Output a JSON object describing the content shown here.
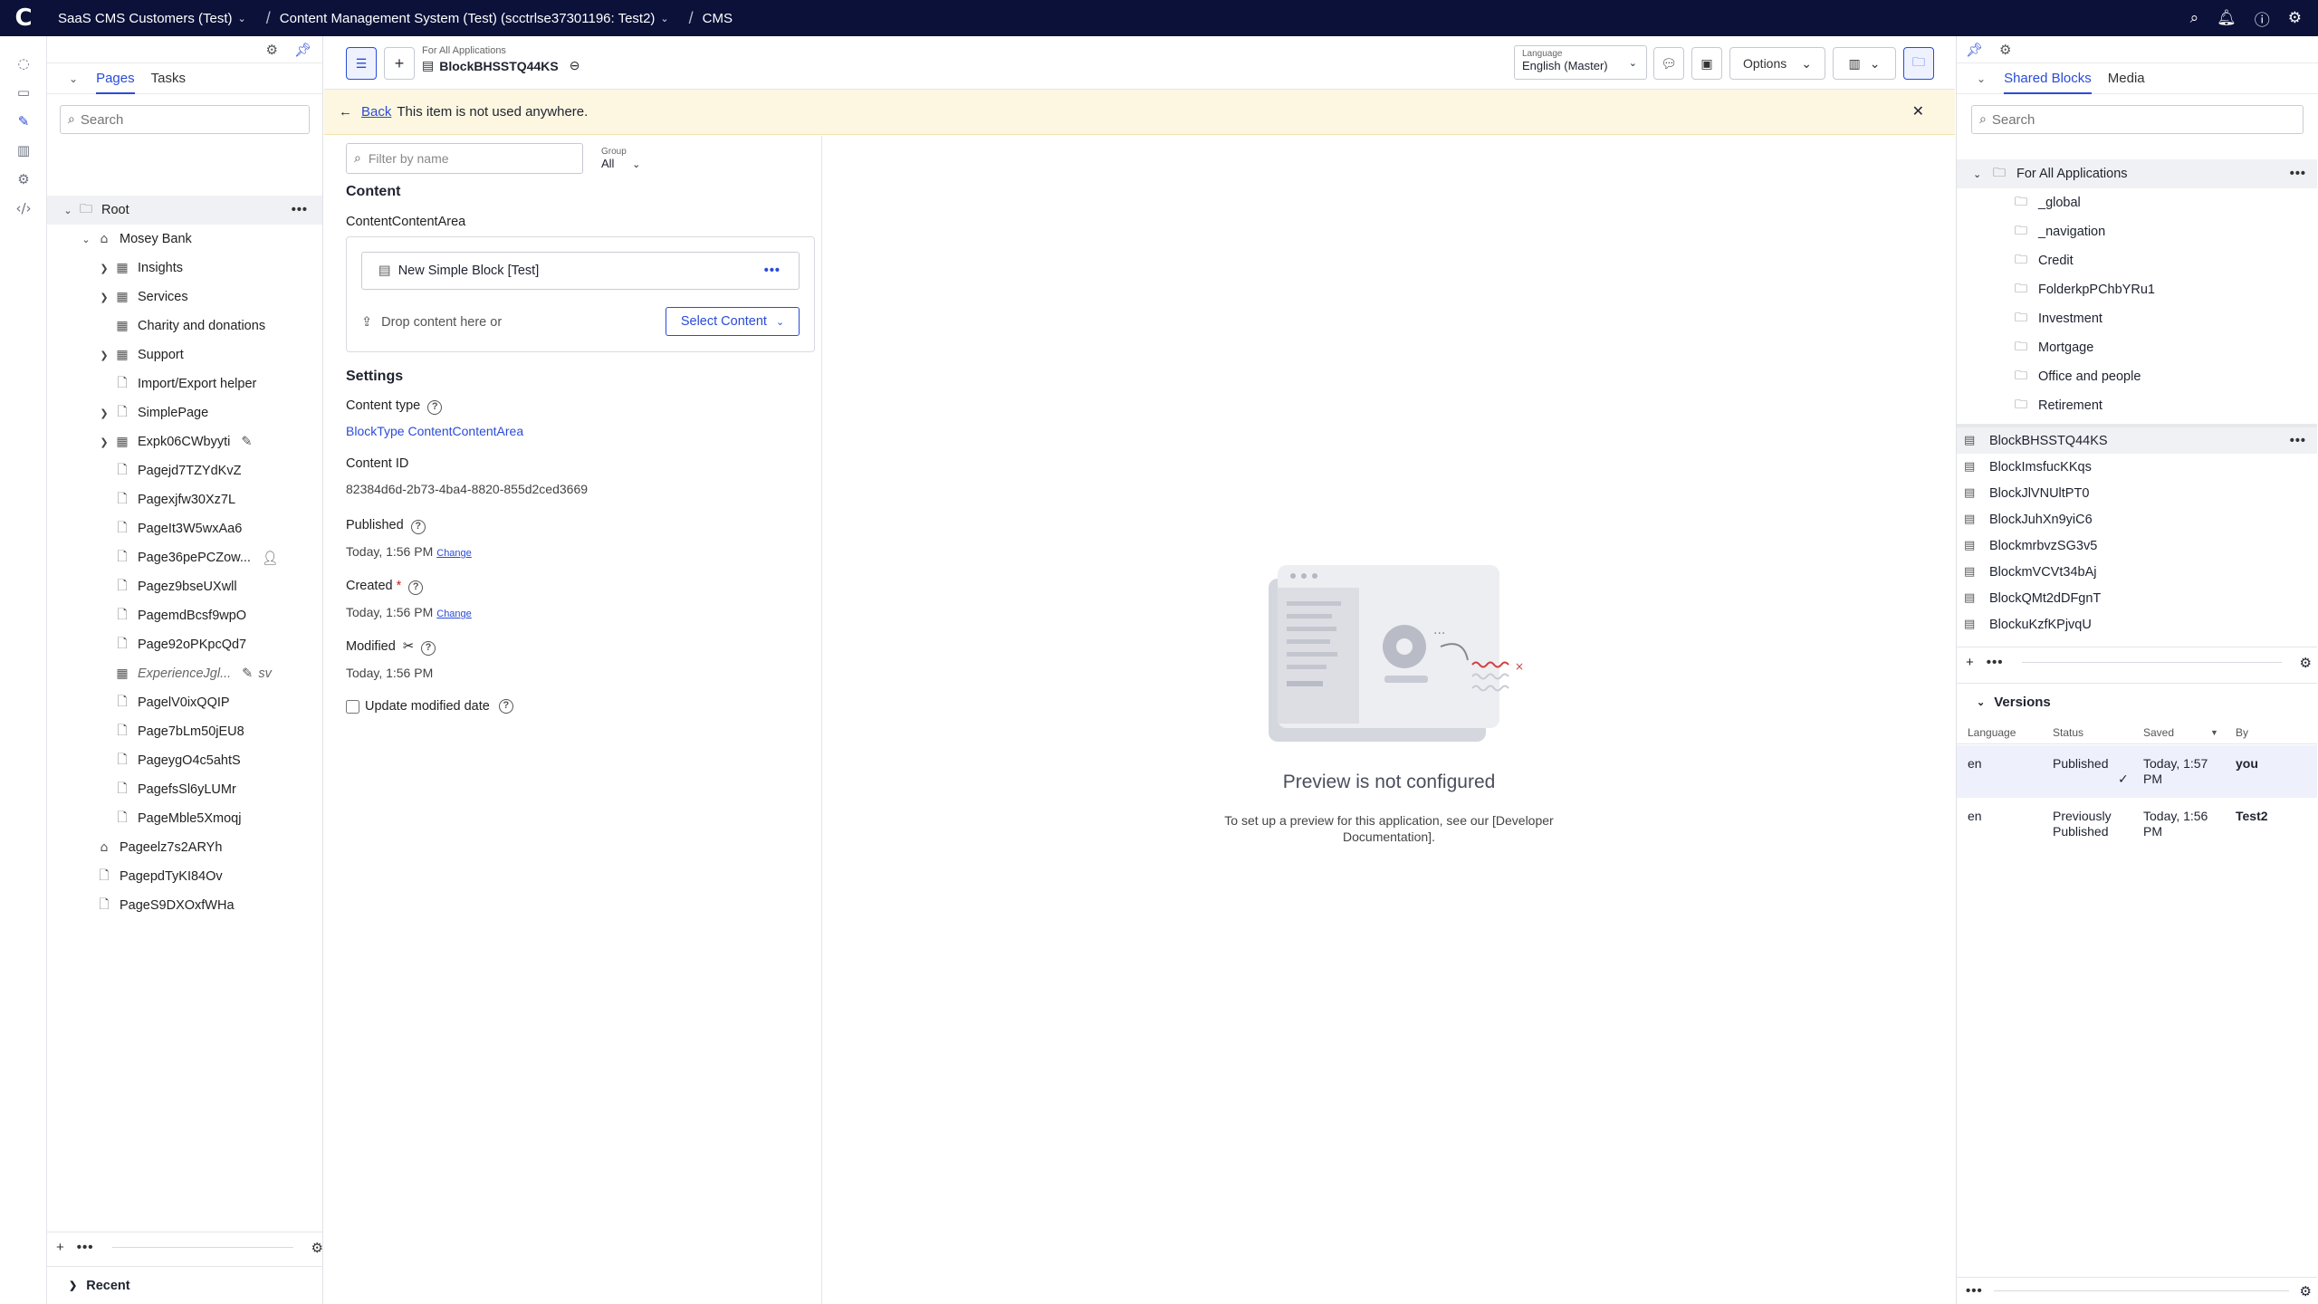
{
  "topbar": {
    "logo": "C",
    "crumbs": [
      "SaaS CMS Customers (Test)",
      "Content Management System (Test) (scctrlse37301196: Test2)",
      "CMS"
    ]
  },
  "pages_panel": {
    "tabs": [
      "Pages",
      "Tasks"
    ],
    "search_placeholder": "Search",
    "tree": [
      {
        "label": "Root",
        "icon": "folder-icon"
      },
      {
        "label": "Mosey Bank",
        "icon": "home-icon"
      },
      {
        "label": "Insights",
        "icon": "table-icon"
      },
      {
        "label": "Services",
        "icon": "table-icon"
      },
      {
        "label": "Charity and donations",
        "icon": "table-icon"
      },
      {
        "label": "Support",
        "icon": "table-icon"
      },
      {
        "label": "Import/Export helper",
        "icon": "page-icon"
      },
      {
        "label": "SimplePage",
        "icon": "page-icon"
      },
      {
        "label": "Expk06CWbyyti",
        "icon": "table-icon"
      },
      {
        "label": "Pagejd7TZYdKvZ",
        "icon": "page-icon"
      },
      {
        "label": "Pagexjfw30Xz7L",
        "icon": "page-icon"
      },
      {
        "label": "PageIt3W5wxAa6",
        "icon": "page-icon"
      },
      {
        "label": "Page36pePCZow...",
        "icon": "page-icon"
      },
      {
        "label": "Pagez9bseUXwll",
        "icon": "page-icon"
      },
      {
        "label": "PagemdBcsf9wpO",
        "icon": "page-icon"
      },
      {
        "label": "Page92oPKpcQd7",
        "icon": "page-icon"
      },
      {
        "label": "ExperienceJgl...",
        "icon": "table-icon",
        "extra": "sv"
      },
      {
        "label": "PagelV0ixQQIP",
        "icon": "page-icon"
      },
      {
        "label": "Page7bLm50jEU8",
        "icon": "page-icon"
      },
      {
        "label": "PageygO4c5ahtS",
        "icon": "page-icon"
      },
      {
        "label": "PagefsSl6yLUMr",
        "icon": "page-icon"
      },
      {
        "label": "PageMble5Xmoqj",
        "icon": "page-icon"
      },
      {
        "label": "Pageelz7s2ARYh",
        "icon": "home-icon"
      },
      {
        "label": "PagepdTyKI84Ov",
        "icon": "page-icon"
      },
      {
        "label": "PageS9DXOxfWHa",
        "icon": "page-icon"
      }
    ],
    "recent_label": "Recent"
  },
  "toolbar": {
    "item_sub": "For All Applications",
    "item_title": "BlockBHSSTQ44KS",
    "language_label": "Language",
    "language_value": "English (Master)",
    "options_label": "Options"
  },
  "notice": {
    "back": "Back",
    "text": "This item is not used anywhere."
  },
  "editor": {
    "filter_placeholder": "Filter by name",
    "group_label": "Group",
    "group_value": "All",
    "content_title": "Content",
    "content_area_label": "ContentContentArea",
    "block_name": "New Simple Block [Test]",
    "drop_text": "Drop content here or",
    "select_content": "Select Content",
    "settings_title": "Settings",
    "content_type_label": "Content type",
    "content_type_value": "BlockType ContentContentArea",
    "content_id_label": "Content ID",
    "content_id_value": "82384d6d-2b73-4ba4-8820-855d2ced3669",
    "published_label": "Published",
    "published_value": "Today, 1:56 PM",
    "change": "Change",
    "created_label": "Created",
    "created_value": "Today, 1:56 PM",
    "modified_label": "Modified",
    "modified_value": "Today, 1:56 PM",
    "update_modified_label": "Update modified date"
  },
  "preview": {
    "title": "Preview is not configured",
    "subtitle": "To set up a preview for this application, see our [Developer Documentation]."
  },
  "right_panel": {
    "tabs": [
      "Shared Blocks",
      "Media"
    ],
    "search_placeholder": "Search",
    "root_folder": "For All Applications",
    "folders": [
      "_global",
      "_navigation",
      "Credit",
      "FolderkpPChbYRu1",
      "Investment",
      "Mortgage",
      "Office and people",
      "Retirement"
    ],
    "blocks": [
      "BlockBHSSTQ44KS",
      "BlockImsfucKKqs",
      "BlockJlVNUltPT0",
      "BlockJuhXn9yiC6",
      "BlockmrbvzSG3v5",
      "BlockmVCVt34bAj",
      "BlockQMt2dDFgnT",
      "BlockuKzfKPjvqU"
    ],
    "versions_title": "Versions",
    "version_cols": [
      "Language",
      "Status",
      "Saved",
      "By"
    ],
    "versions": [
      {
        "lang": "en",
        "status": "Published",
        "saved": "Today, 1:57 PM",
        "by": "you"
      },
      {
        "lang": "en",
        "status": "Previously Published",
        "saved": "Today, 1:56 PM",
        "by": "Test2"
      }
    ]
  },
  "colors": {
    "accent": "#2a4bd8",
    "topbar": "#0b1139",
    "notice": "#fdf7e1"
  }
}
